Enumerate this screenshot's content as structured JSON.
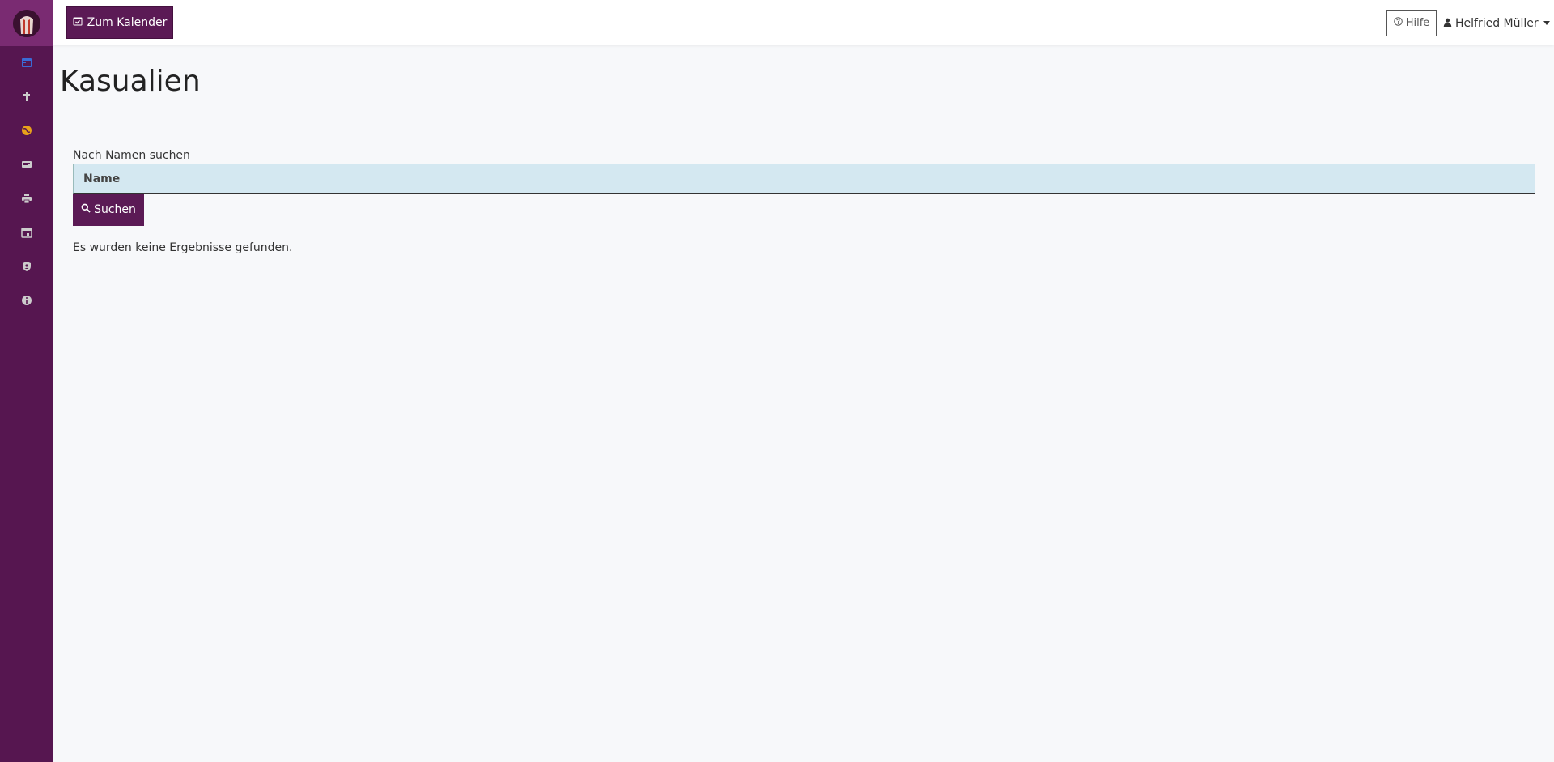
{
  "sidebar": {
    "items": [
      {
        "icon": "calendar-icon"
      },
      {
        "icon": "cross-icon"
      },
      {
        "icon": "globe-icon"
      },
      {
        "icon": "card-icon"
      },
      {
        "icon": "printer-icon"
      },
      {
        "icon": "calendar-event-icon"
      },
      {
        "icon": "user-shield-icon"
      },
      {
        "icon": "info-icon"
      }
    ]
  },
  "topbar": {
    "calendar_button_label": "Zum Kalender",
    "help_button_label": "Hilfe",
    "user_name": "Helfried Müller"
  },
  "main": {
    "title": "Kasualien",
    "search_label": "Nach Namen suchen",
    "search_placeholder": "Name",
    "search_button_label": "Suchen",
    "no_results_text": "Es wurden keine Ergebnisse gefunden."
  },
  "colors": {
    "sidebar": "#561650",
    "primary_button": "#5b1a55",
    "input_bg": "#d4e8f1"
  }
}
